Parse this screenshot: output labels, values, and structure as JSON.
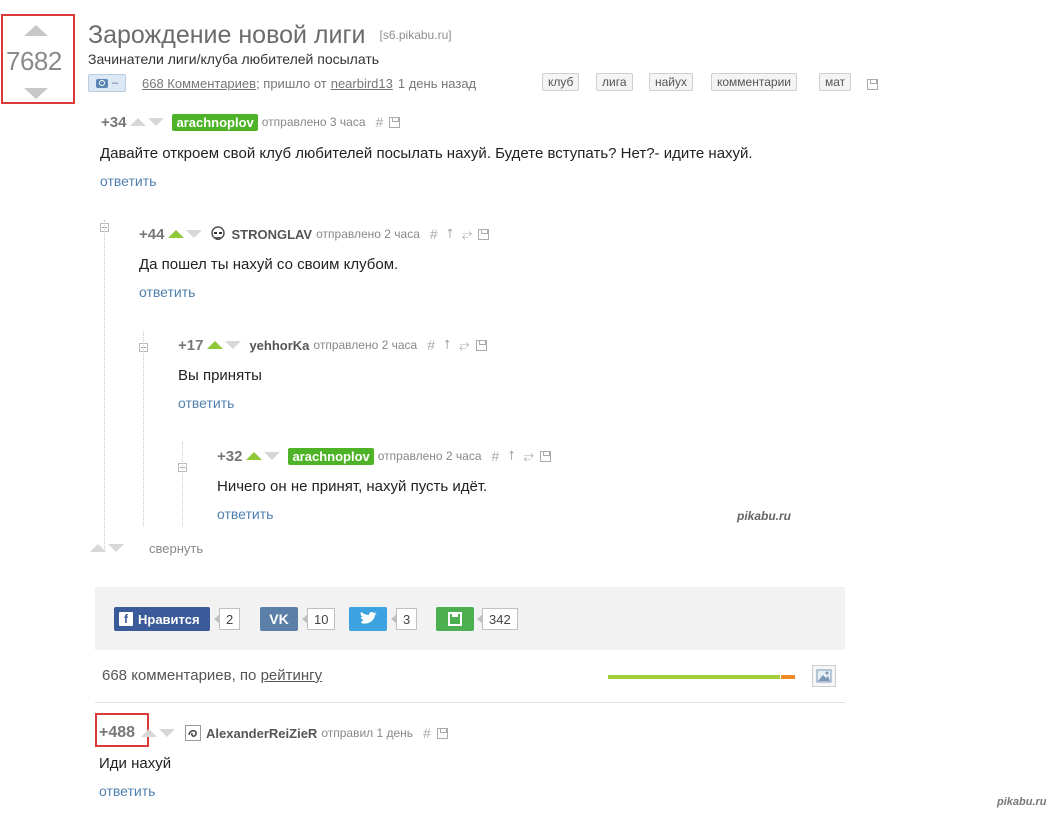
{
  "post": {
    "rating": "7682",
    "title": "Зарождение новой лиги",
    "domain": "[s6.pikabu.ru]",
    "description": "Зачинатели лиги/клуба любителей посылать",
    "photo_badge": "–",
    "comments_link": "668 Комментариев",
    "came_from": "; пришло от",
    "author": "nearbird13",
    "time": "1 день назад",
    "tags": [
      "клуб",
      "лига",
      "найух",
      "комментарии",
      "мат"
    ]
  },
  "comments": [
    {
      "score": "+34",
      "nick": "arachnoplov",
      "sent": "отправлено 3 часа",
      "text": "Давайте откроем свой клуб любителей посылать нахуй. Будете вступать? Нет?- идите нахуй.",
      "reply": "ответить"
    },
    {
      "score": "+44",
      "nick": "STRONGLAV",
      "sent": "отправлено 2 часа",
      "text": "Да пошел ты нахуй со своим клубом.",
      "reply": "ответить"
    },
    {
      "score": "+17",
      "nick": "yehhorKa",
      "sent": "отправлено 2 часа",
      "text": "Вы приняты",
      "reply": "ответить"
    },
    {
      "score": "+32",
      "nick": "arachnoplov",
      "sent": "отправлено 2 часа",
      "text": "Ничего он не принят, нахуй пусть идёт.",
      "reply": "ответить"
    }
  ],
  "collapse_label": "свернуть",
  "watermark": "pikabu.ru",
  "share": {
    "fb_label": "Нравится",
    "fb_count": "2",
    "vk_label": "VK",
    "vk_count": "10",
    "tw_count": "3",
    "save_count": "342"
  },
  "comments_summary": {
    "count_text": "668 комментариев, по ",
    "sort_label": "рейтингу"
  },
  "top_comment": {
    "score": "+488",
    "nick": "AlexanderReiZieR",
    "sent": "отправил 1 день",
    "text": "Иди нахуй",
    "reply": "ответить"
  },
  "corner_watermark": "pikabu.ru",
  "colors": {
    "highlight": "#d93a3a",
    "nick_green": "#4eb327",
    "link": "#4f80b0"
  }
}
